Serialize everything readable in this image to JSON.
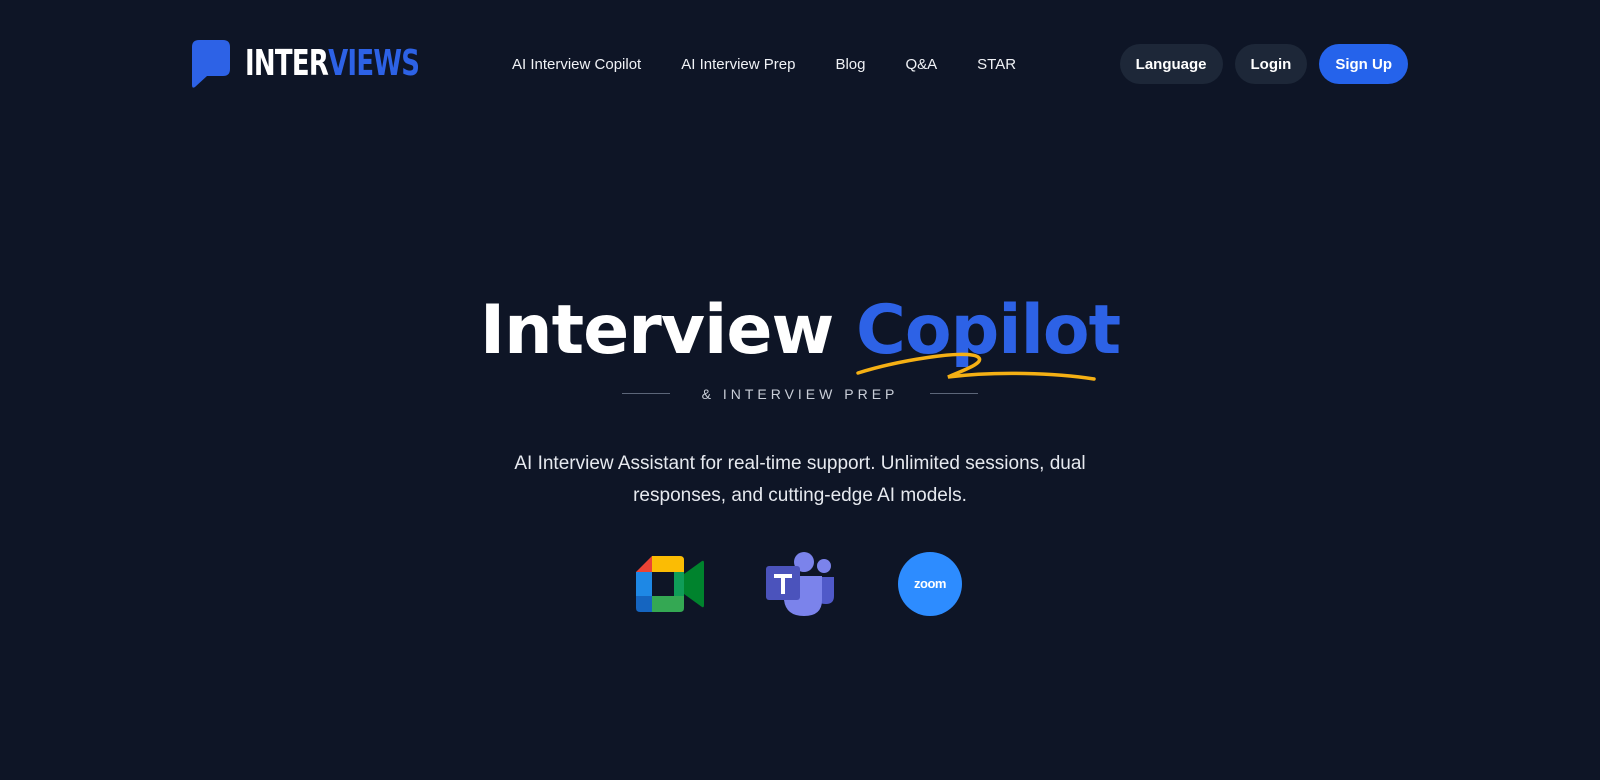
{
  "brand": {
    "name_part_a": "INTER",
    "name_part_b": "VIEWS",
    "colors": {
      "primary": "#2563eb",
      "accent_text": "#2d62e6",
      "highlight": "#f5b014",
      "background": "#0e1526",
      "button_dark": "#1d2738"
    }
  },
  "nav": {
    "items": [
      {
        "label": "AI Interview Copilot"
      },
      {
        "label": "AI Interview Prep"
      },
      {
        "label": "Blog"
      },
      {
        "label": "Q&A"
      },
      {
        "label": "STAR"
      }
    ]
  },
  "actions": {
    "language_label": "Language",
    "login_label": "Login",
    "signup_label": "Sign Up"
  },
  "hero": {
    "title_word_1": "Interview",
    "title_word_2": "Copilot",
    "subtitle": "& INTERVIEW PREP",
    "description": "AI Interview Assistant for real-time support. Unlimited sessions, dual responses, and cutting-edge AI models."
  },
  "platforms": {
    "items": [
      {
        "icon": "google-meet-icon"
      },
      {
        "icon": "microsoft-teams-icon"
      },
      {
        "icon": "zoom-icon",
        "label": "zoom"
      }
    ]
  }
}
